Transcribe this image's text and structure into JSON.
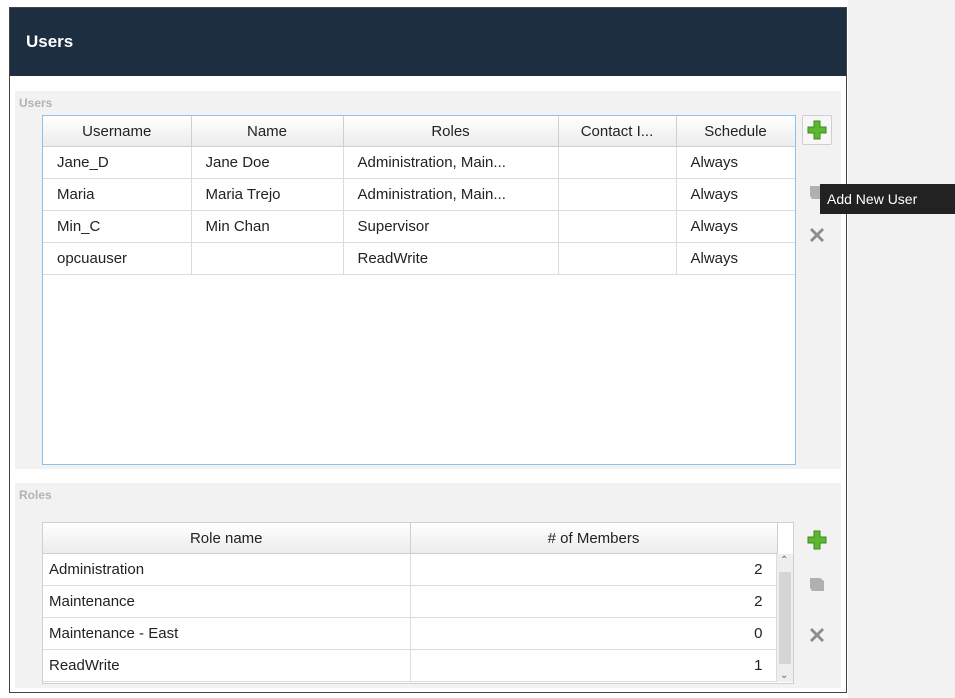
{
  "panel": {
    "title": "Users"
  },
  "users_section": {
    "label": "Users",
    "columns": [
      "Username",
      "Name",
      "Roles",
      "Contact I...",
      "Schedule"
    ],
    "rows": [
      [
        "Jane_D",
        "Jane Doe",
        "Administration, Main...",
        "",
        "Always"
      ],
      [
        "Maria",
        "Maria Trejo",
        "Administration, Main...",
        "",
        "Always"
      ],
      [
        "Min_C",
        "Min Chan",
        "Supervisor",
        "",
        "Always"
      ],
      [
        "opcuauser",
        "",
        "ReadWrite",
        "",
        "Always"
      ]
    ]
  },
  "roles_section": {
    "label": "Roles",
    "columns": [
      "Role name",
      "# of Members"
    ],
    "rows": [
      [
        "Administration",
        "2"
      ],
      [
        "Maintenance",
        "2"
      ],
      [
        "Maintenance - East",
        "0"
      ],
      [
        "ReadWrite",
        "1"
      ]
    ]
  },
  "tooltip": {
    "text": "Add New User"
  },
  "icons": {
    "add": "plus-icon",
    "edit": "edit-icon",
    "delete": "delete-x-icon"
  },
  "colors": {
    "header_bg": "#1c2e40",
    "add_green": "#5cb82e",
    "selection_border": "#8ec2ee"
  }
}
